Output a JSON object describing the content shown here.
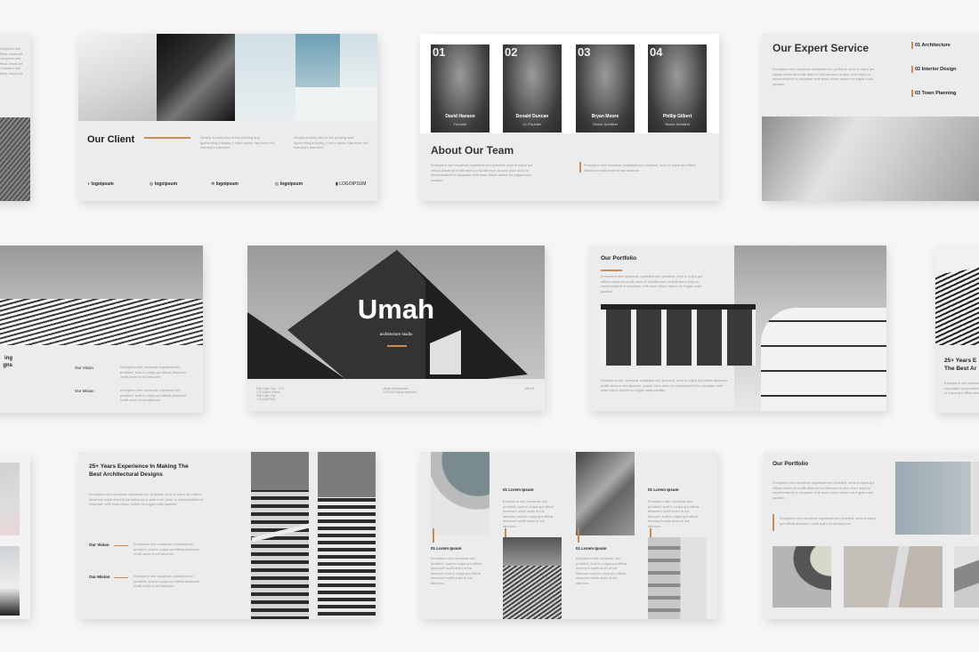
{
  "slides": {
    "client": {
      "title": "Our Client",
      "text1": "Simply dummy text of the printing and typesetting industry. Lorem ipsum has been the industry's standard",
      "text2": "Simply dummy text of the printing and typesetting industry. Lorem ipsum has been the industry's standard",
      "logos": [
        "logoipsum",
        "logoipsum",
        "logoipsum",
        "logoipsum",
        "LOGOIPSUM"
      ]
    },
    "team": {
      "title": "About Our Team",
      "members": [
        {
          "num": "01",
          "name": "David Hanson",
          "role": "Founder"
        },
        {
          "num": "02",
          "name": "Donald Duncan",
          "role": "Co Founder"
        },
        {
          "num": "03",
          "name": "Bryan Moore",
          "role": "Senior Architect"
        },
        {
          "num": "04",
          "name": "Phillip Gilbert",
          "role": "Senior Architect"
        }
      ],
      "text1": "Excepteur sint occaecat cupidatat non proident, sunt in culpa qui officia deserunt mollit anim id est laborum ut aute irure dolor in reprehenderit in voluptate velit esse cillum dolore eu fugiat nulla pariatur",
      "text2": "Excepteur sint occaecat cupidatat non proident, sunt in culpa qui officia deserunt mollit anim id est laborum"
    },
    "service": {
      "title": "Our Expert Service",
      "text": "Excepteur sint occaecat cupidatat non proident, sunt in culpa qui officia deserunt mollit anim id est laborum ut aute irure dolor in reprehenderit in voluptate velit esse cillum dolore eu fugiat nulla pariatur",
      "items": [
        "01 Architecture",
        "02 Interior Design",
        "03 Town Planning"
      ]
    },
    "vision_left": {
      "heading_partial": "...ing\n...gns",
      "vision_label": "Our Vision",
      "mission_label": "Our Mision",
      "vision_text": "Excepteur sint occaecat cupidatat non proident, sunt in culpa qui officia deserunt mollit anim id est laborum",
      "mission_text": "Excepteur sint occaecat cupidatat non proident, sunt in culpa qui officia deserunt mollit anim id est laborum"
    },
    "cover": {
      "title": "Umah",
      "subtitle": "architecture studio",
      "address": "Salt Lake City · 123\n123 Match Street\nSalt Lake City\n+1234567890",
      "copyright": "Umah Architecture\n2023 All Rights reserved",
      "right_label": "MENU"
    },
    "portfolio1": {
      "title": "Our Portfolio",
      "text1": "Excepteur sint occaecat cupidatat non proident, sunt in culpa qui officia deserunt mollit anim id est laborum ut aute irure dolor in reprehenderit in voluptate velit esse cillum dolore eu fugiat nulla pariatur",
      "text2": "Excepteur sint occaecat cupidatat non proident, sunt in culpa qui officia deserunt mollit anim id est laborum ut aute irure dolor in reprehenderit in voluptate velit esse cillum dolore eu fugiat nulla pariatur"
    },
    "edge_right": {
      "heading": "25+ Years E...\nThe Best Ar..."
    },
    "experience": {
      "heading": "25+ Years Experience In Making The Best Architectural Designs",
      "text": "Excepteur sint occaecat cupidatat non proident, sunt in culpa qui officia deserunt mollit anim id est laborum ut aute irure dolor in reprehenderit in voluptate velit esse cillum dolore eu fugiat nulla pariatur",
      "vision_label": "Our Vision",
      "mission_label": "Our Mision",
      "vision_text": "Excepteur sint occaecat cupidatat non proident, sunt in culpa qui officia deserunt mollit anim id est laborum",
      "mission_text": "Excepteur sint occaecat cupidatat non proident, sunt in culpa qui officia deserunt mollit anim id est laborum"
    },
    "lorem_grid": {
      "items": [
        {
          "title": "01 Lorem Ipsum",
          "text": "Excepteur sint occaecat non proident, sunt in culpa qui officia deserunt mollit anim id est laborum sunt in culpa qui officia deserunt mollit anim id est laborum"
        },
        {
          "title": "01 Lorem Ipsum",
          "text": "Excepteur sint occaecat non proident, sunt in culpa qui officia deserunt mollit anim id est laborum sunt in culpa qui officia deserunt mollit anim id est laborum"
        },
        {
          "title": "01 Lorem Ipsum",
          "text": "Excepteur sint occaecat non proident, sunt in culpa qui officia deserunt mollit anim id est laborum sunt in culpa qui officia deserunt mollit anim id est laborum"
        },
        {
          "title": "01 Lorem Ipsum",
          "text": "Excepteur sint occaecat non proident, sunt in culpa qui officia deserunt mollit anim id est laborum sunt in culpa qui officia deserunt mollit anim id est laborum"
        }
      ]
    },
    "portfolio2": {
      "title": "Our Portfolio",
      "text1": "Excepteur sint occaecat cupidatat non proident, sunt in culpa qui officia deserunt mollit anim id est laborum ut aute irure dolor in reprehenderit in voluptate velit esse cillum dolore eu fugiat nulla pariatur",
      "text2": "Excepteur sint occaecat cupidatat non proident, sunt in culpa qui officia deserunt mollit anim id est laborum"
    }
  },
  "colors": {
    "background": "#f6f6f6",
    "slide": "#ececec",
    "accent": "#c98a55",
    "text_dark": "#222222",
    "text_muted": "#9a9a9a"
  }
}
